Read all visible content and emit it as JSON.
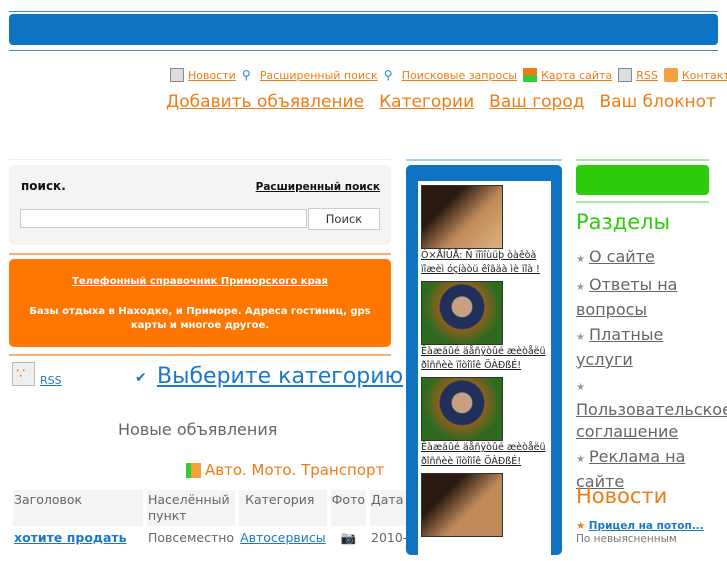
{
  "header": {
    "links": [
      {
        "label": "Новости",
        "icon": "document-icon"
      },
      {
        "label": "Расширенный поиск",
        "icon": "magnifier-icon"
      },
      {
        "label": "Поисковые запросы",
        "icon": "magnifier-plus-icon"
      },
      {
        "label": "Карта сайта",
        "icon": "sitemap-icon"
      },
      {
        "label": "RSS",
        "icon": "rss-document-icon"
      },
      {
        "label": "Контакты",
        "icon": "mail-icon"
      }
    ],
    "nav": [
      "Добавить объявление",
      "Категории",
      "Ваш город",
      "Ваш блокнот"
    ]
  },
  "search": {
    "title": "поиск.",
    "advanced": "Расширенный поиск",
    "value": "",
    "button": "Поиск"
  },
  "promo": {
    "link": "Телефонный справочник Приморского края",
    "text": "Базы отдыха в Находке, и Приморе. Адреса гостиниц, gps карты и многое другое."
  },
  "rss": "RSS",
  "choose_category": "Выберите категорию",
  "new_ads": "Новые объявления",
  "category": "Авто. Мото. Транспорт",
  "table": {
    "headers": [
      "Заголовок",
      "Населённый пункт",
      "Категория",
      "Фото",
      "Дата"
    ],
    "rows": [
      {
        "title": "хотите продать",
        "place": "Повсеместно",
        "category": "Автосервисы",
        "date": "2010-"
      }
    ]
  },
  "ads": [
    {
      "text": "Ó×ÅÍÛÅ: Ñ ïîìîùüþ òàêòà ïîæèì óçíàòü êîãäà ìè ïîà !"
    },
    {
      "text": "Êàæäûé äåñÿòûé æèòåëü ðîññèè ïîòîìîê ÖÀÐßÉ!"
    },
    {
      "text": "Êàæäûé äåñÿòûé æèòåëü ðîññèè ïîòîìîê ÖÀÐßÉ!"
    }
  ],
  "sections": {
    "title": "Разделы",
    "items": [
      "О сайте",
      "Ответы на вопросы",
      "Платные услуги",
      "Пользовательское соглашение",
      "Реклама на сайте"
    ]
  },
  "news": {
    "title": "Новости",
    "items": [
      {
        "title": "Прицел на потоп...",
        "text": "По невыясненным"
      }
    ]
  },
  "colors": {
    "blue": "#0e73c2",
    "orange": "#ff7600",
    "green": "#2ecc0a",
    "link_orange": "#f07b12"
  }
}
